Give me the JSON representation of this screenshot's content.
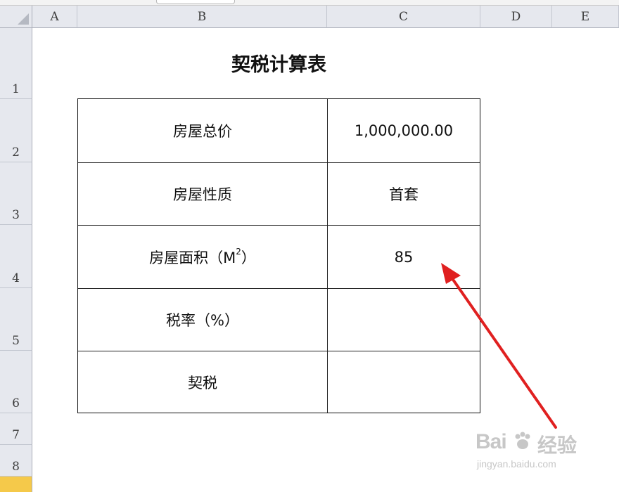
{
  "columns": [
    "A",
    "B",
    "C",
    "D",
    "E"
  ],
  "rows": [
    "1",
    "2",
    "3",
    "4",
    "5",
    "6",
    "7",
    "8"
  ],
  "title": "契税计算表",
  "table": [
    {
      "label": "房屋总价",
      "value": "1,000,000.00"
    },
    {
      "label": "房屋性质",
      "value": "首套"
    },
    {
      "label": "房屋面积（M",
      "label_sup": "2",
      "label_tail": "）",
      "value": "85"
    },
    {
      "label": "税率（%）",
      "value": ""
    },
    {
      "label": "契税",
      "value": ""
    }
  ],
  "watermark": {
    "brand_a": "Bai",
    "brand_b": "经验",
    "url": "jingyan.baidu.com"
  },
  "colors": {
    "arrow": "#e02020",
    "header_bg": "#e6e8ee",
    "selected_row": "#f5c94a"
  }
}
